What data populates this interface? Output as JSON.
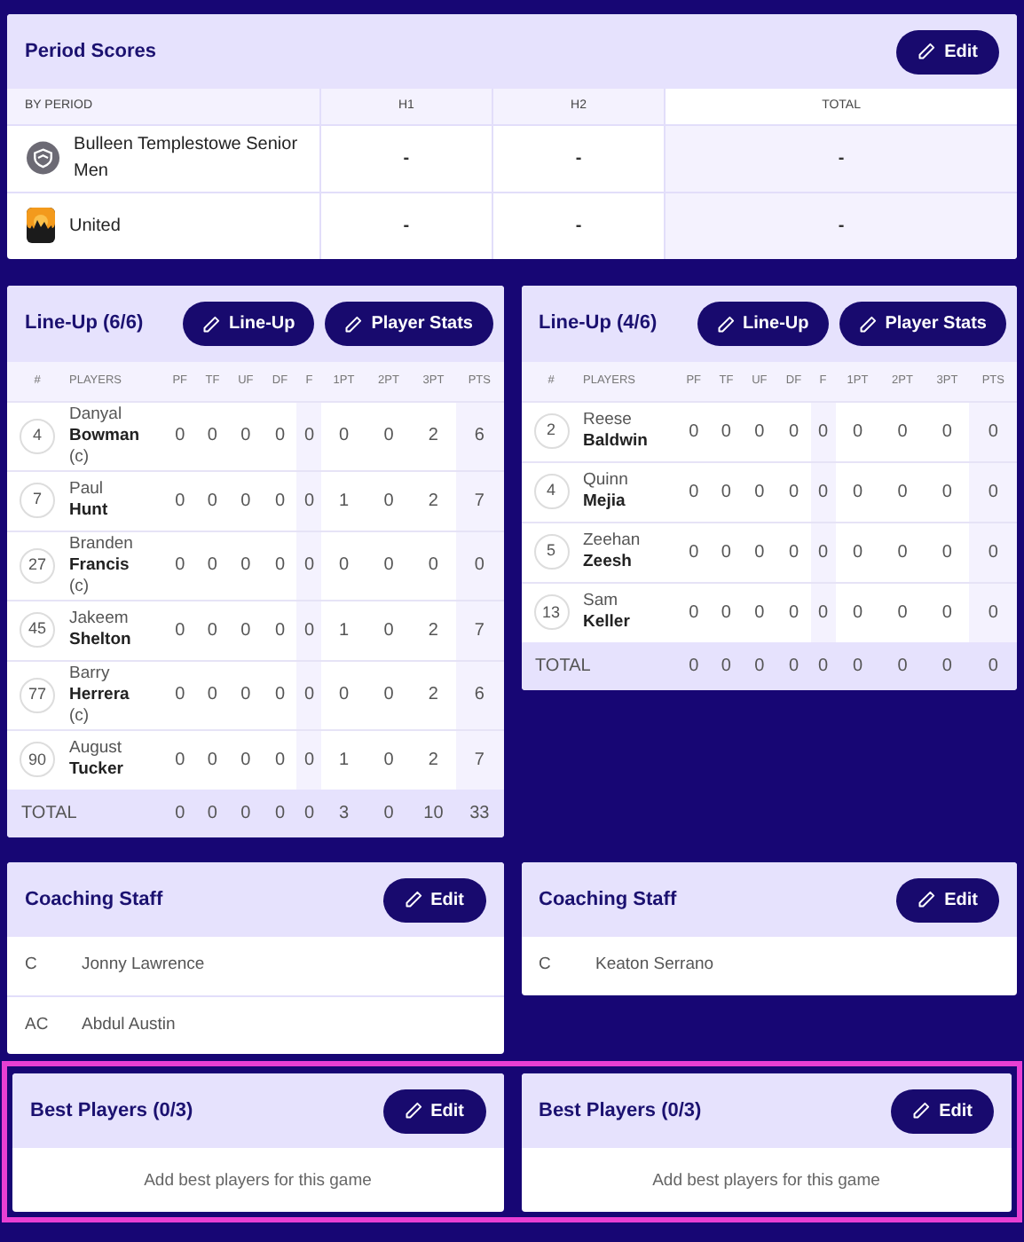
{
  "period_scores": {
    "title": "Period Scores",
    "edit_button": "Edit",
    "columns": [
      "BY PERIOD",
      "H1",
      "H2",
      "TOTAL"
    ],
    "rows": [
      {
        "team": "Bulleen Templestowe Senior Men",
        "kind": "shield",
        "h1": "-",
        "h2": "-",
        "total": "-"
      },
      {
        "team": "United",
        "kind": "sunset",
        "h1": "-",
        "h2": "-",
        "total": "-"
      }
    ]
  },
  "lineups": [
    {
      "title": "Line-Up (6/6)",
      "buttons": [
        "Line-Up",
        "Player Stats"
      ],
      "columns": [
        "#",
        "PLAYERS",
        "PF",
        "TF",
        "UF",
        "DF",
        "F",
        "1PT",
        "2PT",
        "3PT",
        "PTS"
      ],
      "players": [
        {
          "number": "4",
          "first": "Danyal",
          "last": "Bowman",
          "captain": "(c)",
          "stats": [
            "0",
            "0",
            "0",
            "0",
            "0",
            "0",
            "0",
            "2",
            "6"
          ]
        },
        {
          "number": "7",
          "first": "Paul",
          "last": "Hunt",
          "stats": [
            "0",
            "0",
            "0",
            "0",
            "0",
            "1",
            "0",
            "2",
            "7"
          ]
        },
        {
          "number": "27",
          "first": "Branden",
          "last": "Francis",
          "captain": "(c)",
          "stats": [
            "0",
            "0",
            "0",
            "0",
            "0",
            "0",
            "0",
            "0",
            "0"
          ]
        },
        {
          "number": "45",
          "first": "Jakeem",
          "last": "Shelton",
          "stats": [
            "0",
            "0",
            "0",
            "0",
            "0",
            "1",
            "0",
            "2",
            "7"
          ]
        },
        {
          "number": "77",
          "first": "Barry",
          "last": "Herrera",
          "captain": "(c)",
          "stats": [
            "0",
            "0",
            "0",
            "0",
            "0",
            "0",
            "0",
            "2",
            "6"
          ]
        },
        {
          "number": "90",
          "first": "August",
          "last": "Tucker",
          "stats": [
            "0",
            "0",
            "0",
            "0",
            "0",
            "1",
            "0",
            "2",
            "7"
          ]
        }
      ],
      "total": {
        "label": "TOTAL",
        "values": [
          "0",
          "0",
          "0",
          "0",
          "0",
          "3",
          "0",
          "10",
          "33"
        ]
      }
    },
    {
      "title": "Line-Up (4/6)",
      "buttons": [
        "Line-Up",
        "Player Stats"
      ],
      "columns": [
        "#",
        "PLAYERS",
        "PF",
        "TF",
        "UF",
        "DF",
        "F",
        "1PT",
        "2PT",
        "3PT",
        "PTS"
      ],
      "players": [
        {
          "number": "2",
          "first": "Reese",
          "last": "Baldwin",
          "stats": [
            "0",
            "0",
            "0",
            "0",
            "0",
            "0",
            "0",
            "0",
            "0"
          ]
        },
        {
          "number": "4",
          "first": "Quinn",
          "last": "Mejia",
          "stats": [
            "0",
            "0",
            "0",
            "0",
            "0",
            "0",
            "0",
            "0",
            "0"
          ]
        },
        {
          "number": "5",
          "first": "Zeehan",
          "last": "Zeesh",
          "stats": [
            "0",
            "0",
            "0",
            "0",
            "0",
            "0",
            "0",
            "0",
            "0"
          ]
        },
        {
          "number": "13",
          "first": "Sam",
          "last": "Keller",
          "stats": [
            "0",
            "0",
            "0",
            "0",
            "0",
            "0",
            "0",
            "0",
            "0"
          ]
        }
      ],
      "total": {
        "label": "TOTAL",
        "values": [
          "0",
          "0",
          "0",
          "0",
          "0",
          "0",
          "0",
          "0",
          "0"
        ]
      }
    }
  ],
  "coaching_staff": [
    {
      "title": "Coaching Staff",
      "edit_button": "Edit",
      "staff": [
        {
          "role": "C",
          "name": "Jonny Lawrence"
        },
        {
          "role": "AC",
          "name": "Abdul Austin"
        }
      ]
    },
    {
      "title": "Coaching Staff",
      "edit_button": "Edit",
      "staff": [
        {
          "role": "C",
          "name": "Keaton Serrano"
        }
      ]
    }
  ],
  "best_players": {
    "highlighted": true,
    "cards": [
      {
        "title": "Best Players (0/3)",
        "edit_button": "Edit",
        "empty_text": "Add best players for this game"
      },
      {
        "title": "Best Players (0/3)",
        "edit_button": "Edit",
        "empty_text": "Add best players for this game"
      }
    ]
  }
}
